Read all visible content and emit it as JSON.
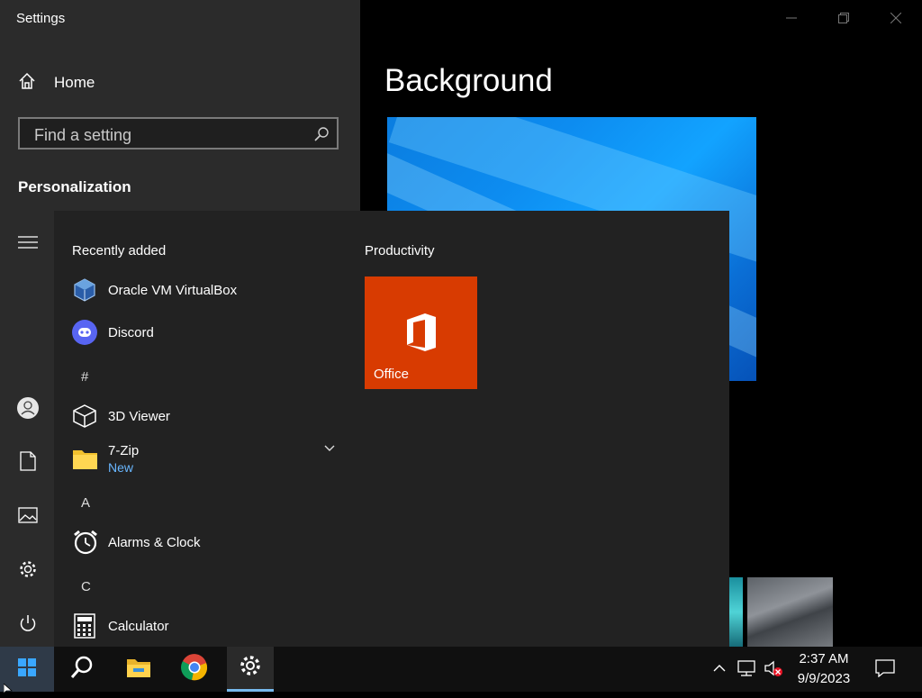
{
  "settings": {
    "title": "Settings",
    "home_label": "Home",
    "search_placeholder": "Find a setting",
    "section_title": "Personalization",
    "page_title": "Background"
  },
  "start_menu": {
    "recently_added_label": "Recently added",
    "productivity_label": "Productivity",
    "recent_apps": [
      {
        "name": "Oracle VM VirtualBox",
        "icon": "virtualbox-icon"
      },
      {
        "name": "Discord",
        "icon": "discord-icon"
      }
    ],
    "letters": [
      "#",
      "A",
      "C"
    ],
    "apps": [
      {
        "name": "3D Viewer",
        "icon": "cube-icon"
      },
      {
        "name": "7-Zip",
        "subtitle": "New",
        "icon": "folder-icon"
      },
      {
        "name": "Alarms & Clock",
        "icon": "alarm-clock-icon"
      },
      {
        "name": "Calculator",
        "icon": "calculator-icon"
      }
    ],
    "tiles": [
      {
        "name": "Office",
        "color": "#d83b01",
        "icon": "office-icon"
      }
    ]
  },
  "taskbar": {
    "time": "2:37 AM",
    "date": "9/9/2023",
    "pinned": [
      "windows-start-icon",
      "search-icon",
      "file-explorer-icon",
      "chrome-icon",
      "settings-gear-icon"
    ]
  },
  "colors": {
    "accent": "#76b9ed",
    "office_tile": "#d83b01",
    "new_badge": "#69b7ff",
    "discord": "#5865f2"
  }
}
